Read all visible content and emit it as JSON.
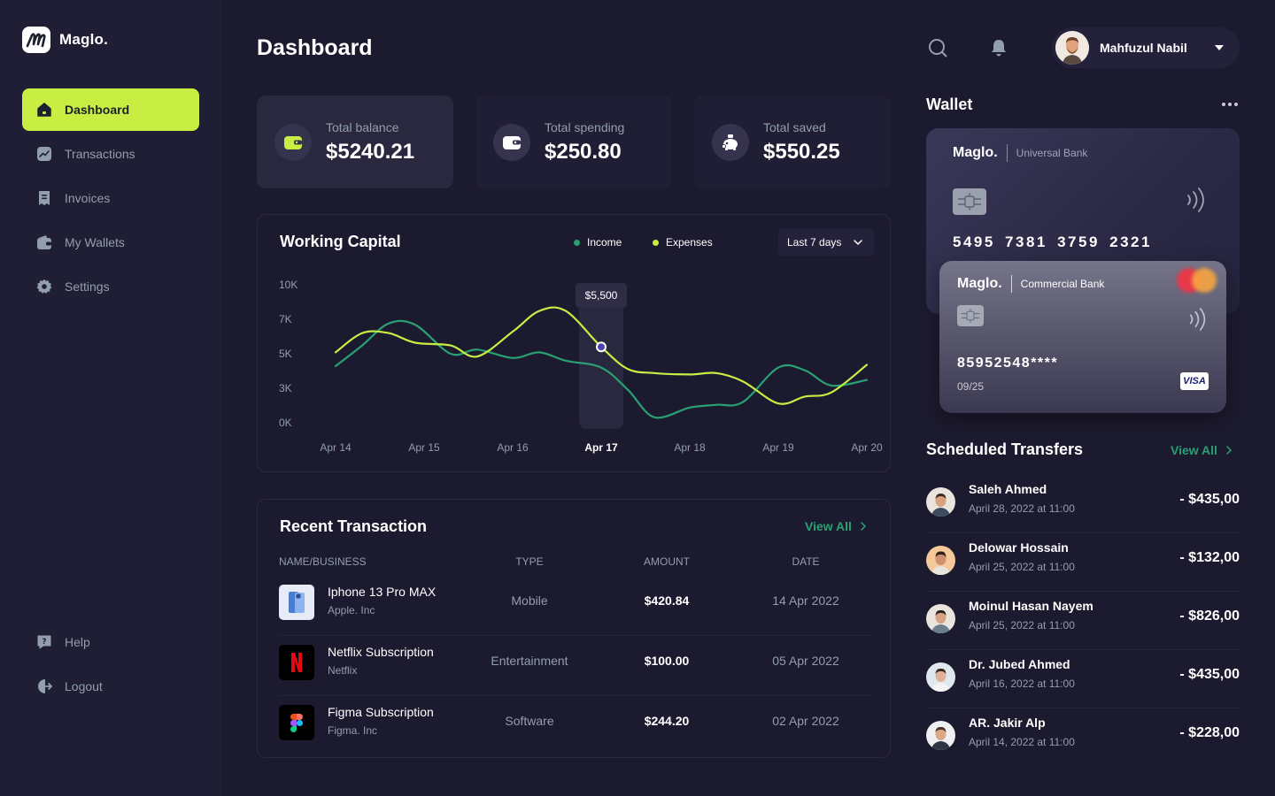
{
  "app": {
    "name": "Maglo."
  },
  "sidebar": {
    "items": [
      {
        "label": "Dashboard",
        "icon": "home-icon",
        "active": true
      },
      {
        "label": "Transactions",
        "icon": "transactions-icon"
      },
      {
        "label": "Invoices",
        "icon": "invoices-icon"
      },
      {
        "label": "My Wallets",
        "icon": "wallet-icon"
      },
      {
        "label": "Settings",
        "icon": "gear-icon"
      }
    ],
    "bottom": [
      {
        "label": "Help",
        "icon": "help-icon"
      },
      {
        "label": "Logout",
        "icon": "logout-icon"
      }
    ]
  },
  "header": {
    "title": "Dashboard",
    "user": {
      "name": "Mahfuzul Nabil"
    }
  },
  "stats": [
    {
      "label": "Total balance",
      "value": "$5240.21",
      "icon": "wallet-icon"
    },
    {
      "label": "Total spending",
      "value": "$250.80",
      "icon": "card-wallet-icon"
    },
    {
      "label": "Total saved",
      "value": "$550.25",
      "icon": "piggy-bank-icon"
    }
  ],
  "working_capital": {
    "title": "Working Capital",
    "legend": {
      "income": "Income",
      "expenses": "Expenses"
    },
    "range": "Last 7 days",
    "tooltip": "$5,500",
    "active_label": "Apr 17",
    "colors": {
      "income": "#29a073",
      "expenses": "#c8ee44"
    }
  },
  "chart_data": {
    "type": "line",
    "title": "Working Capital",
    "categories": [
      "Apr 14",
      "Apr 15",
      "Apr 16",
      "Apr 17",
      "Apr 18",
      "Apr 19",
      "Apr 20"
    ],
    "y_ticks": [
      "10K",
      "7K",
      "5K",
      "3K",
      "0K"
    ],
    "ylim": [
      0,
      10
    ],
    "grid": false,
    "legend_position": "top",
    "highlight": {
      "category": "Apr 17",
      "value": 5500,
      "label": "$5,500"
    },
    "series": [
      {
        "name": "Income",
        "color": "#29a073",
        "x": [
          14.0,
          14.3,
          14.6,
          14.9,
          15.3,
          15.6,
          16.0,
          16.3,
          16.6,
          17.0,
          17.3,
          17.6,
          18.0,
          18.3,
          18.6,
          19.0,
          19.3,
          19.6,
          20.0
        ],
        "y": [
          4.1,
          5.6,
          7.2,
          7.1,
          5.0,
          5.3,
          4.7,
          5.1,
          4.5,
          4.0,
          2.4,
          0.4,
          1.1,
          1.3,
          1.5,
          4.0,
          3.8,
          2.7,
          3.1
        ]
      },
      {
        "name": "Expenses",
        "color": "#c8ee44",
        "x": [
          14.0,
          14.3,
          14.6,
          14.9,
          15.3,
          15.6,
          16.0,
          16.3,
          16.6,
          17.0,
          17.3,
          17.6,
          18.0,
          18.3,
          18.6,
          19.0,
          19.3,
          19.6,
          20.0
        ],
        "y": [
          5.1,
          6.5,
          6.5,
          5.8,
          5.6,
          4.8,
          6.6,
          8.1,
          8.1,
          5.5,
          3.9,
          3.6,
          3.5,
          3.6,
          3.0,
          1.4,
          1.9,
          2.2,
          4.2
        ]
      }
    ]
  },
  "recent_transactions": {
    "title": "Recent Transaction",
    "view_all": "View All",
    "columns": [
      "NAME/BUSINESS",
      "TYPE",
      "AMOUNT",
      "DATE"
    ],
    "rows": [
      {
        "name": "Iphone 13 Pro MAX",
        "business": "Apple. Inc",
        "type": "Mobile",
        "amount": "$420.84",
        "date": "14 Apr 2022",
        "logo": "iphone-icon"
      },
      {
        "name": "Netflix Subscription",
        "business": "Netflix",
        "type": "Entertainment",
        "amount": "$100.00",
        "date": "05 Apr 2022",
        "logo": "netflix-icon"
      },
      {
        "name": "Figma Subscription",
        "business": "Figma. Inc",
        "type": "Software",
        "amount": "$244.20",
        "date": "02 Apr 2022",
        "logo": "figma-icon"
      }
    ]
  },
  "wallet": {
    "title": "Wallet",
    "back_card": {
      "brand": "Maglo.",
      "bank": "Universal Bank",
      "number": "5495 7381 3759 2321"
    },
    "front_card": {
      "brand": "Maglo.",
      "bank": "Commercial Bank",
      "number": "85952548****",
      "expiry": "09/25",
      "network": "VISA"
    }
  },
  "scheduled": {
    "title": "Scheduled Transfers",
    "view_all": "View All",
    "rows": [
      {
        "name": "Saleh Ahmed",
        "date": "April 28, 2022 at 11:00",
        "amount": "- $435,00"
      },
      {
        "name": "Delowar Hossain",
        "date": "April 25, 2022 at 11:00",
        "amount": "- $132,00"
      },
      {
        "name": "Moinul Hasan Nayem",
        "date": "April 25, 2022 at 11:00",
        "amount": "- $826,00"
      },
      {
        "name": "Dr. Jubed Ahmed",
        "date": "April 16, 2022 at 11:00",
        "amount": "- $435,00"
      },
      {
        "name": "AR. Jakir Alp",
        "date": "April 14, 2022 at 11:00",
        "amount": "- $228,00"
      }
    ]
  }
}
